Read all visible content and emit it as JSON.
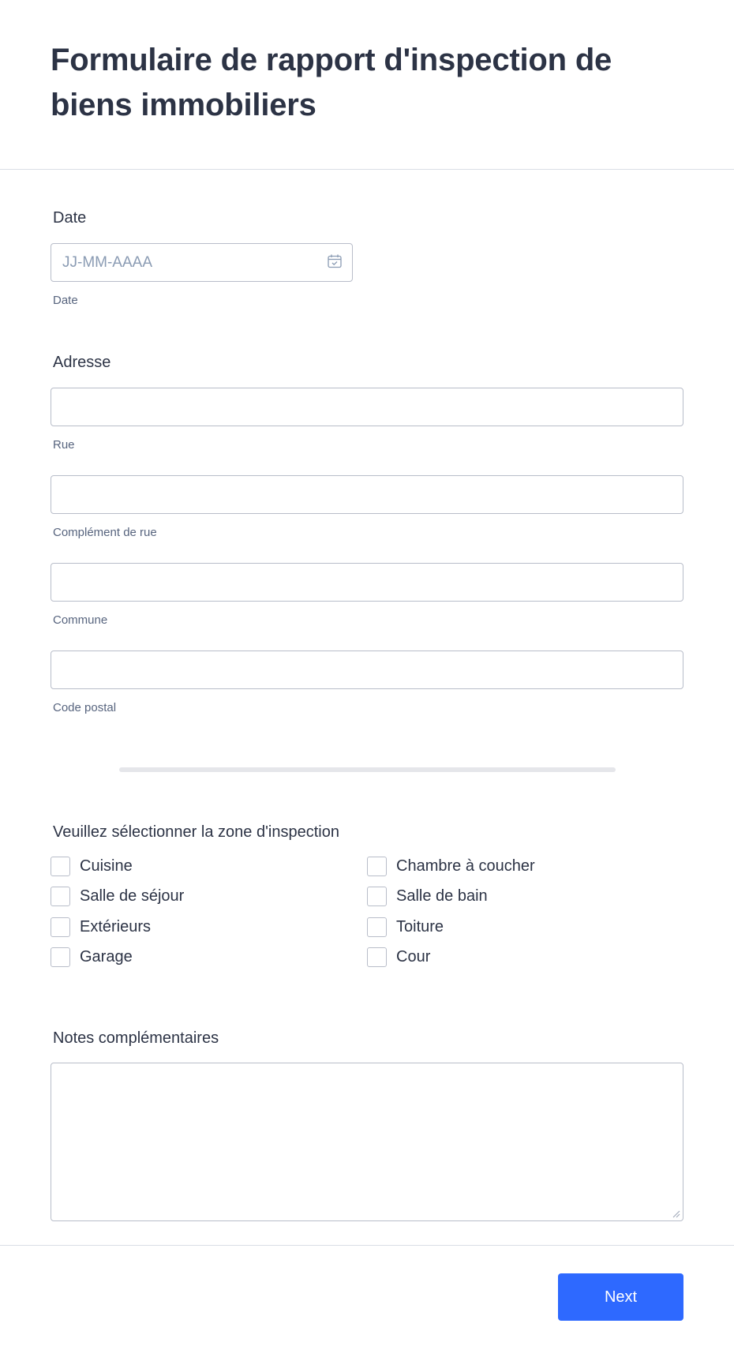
{
  "header": {
    "title": "Formulaire de rapport d'inspection de biens immobiliers"
  },
  "date": {
    "label": "Date",
    "placeholder": "JJ-MM-AAAA",
    "value": "",
    "sublabel": "Date",
    "icon": "calendar-icon"
  },
  "address": {
    "label": "Adresse",
    "fields": [
      {
        "value": "",
        "sublabel": "Rue"
      },
      {
        "value": "",
        "sublabel": "Complément de rue"
      },
      {
        "value": "",
        "sublabel": "Commune"
      },
      {
        "value": "",
        "sublabel": "Code postal"
      }
    ]
  },
  "zones": {
    "label": "Veuillez sélectionner la zone d'inspection",
    "options": [
      {
        "label": "Cuisine",
        "checked": false
      },
      {
        "label": "Chambre à coucher",
        "checked": false
      },
      {
        "label": "Salle de séjour",
        "checked": false
      },
      {
        "label": "Salle de bain",
        "checked": false
      },
      {
        "label": "Extérieurs",
        "checked": false
      },
      {
        "label": "Toiture",
        "checked": false
      },
      {
        "label": "Garage",
        "checked": false
      },
      {
        "label": "Cour",
        "checked": false
      }
    ]
  },
  "notes": {
    "label": "Notes complémentaires",
    "value": ""
  },
  "footer": {
    "next_label": "Next"
  },
  "colors": {
    "accent": "#2e69ff",
    "text": "#2c3345",
    "sublabel": "#57647e",
    "border": "#b8bdc9"
  }
}
